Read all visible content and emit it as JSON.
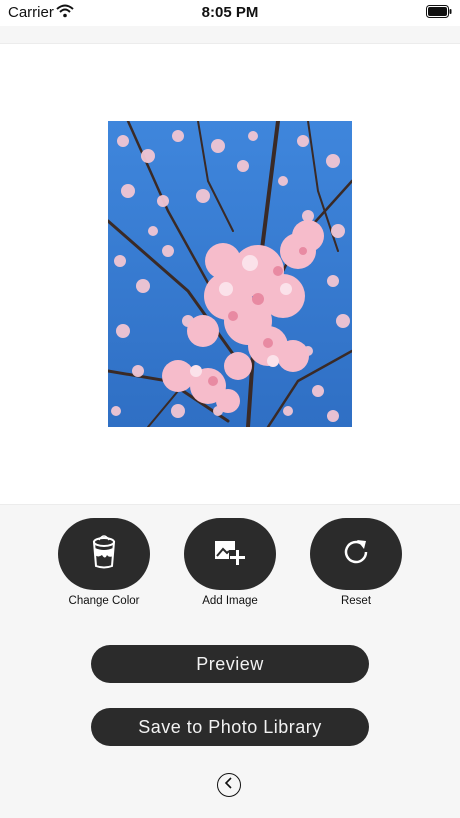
{
  "status_bar": {
    "carrier": "Carrier",
    "time": "8:05 PM",
    "icons": [
      "wifi-icon",
      "battery-icon"
    ]
  },
  "canvas": {
    "photo": "cherry-blossom-photo"
  },
  "tools": [
    {
      "label": "Change Color",
      "icon": "paint-bucket-icon"
    },
    {
      "label": "Add Image",
      "icon": "add-image-icon"
    },
    {
      "label": "Reset",
      "icon": "reset-icon"
    }
  ],
  "actions": {
    "preview_label": "Preview",
    "save_label": "Save to Photo Library"
  },
  "navigation": {
    "back_icon": "chevron-left-icon"
  },
  "colors": {
    "button_bg": "#2b2b2b",
    "button_text": "#f2f2f2",
    "sky": "#3a7fd6",
    "blossom": "#f4b8c8"
  }
}
